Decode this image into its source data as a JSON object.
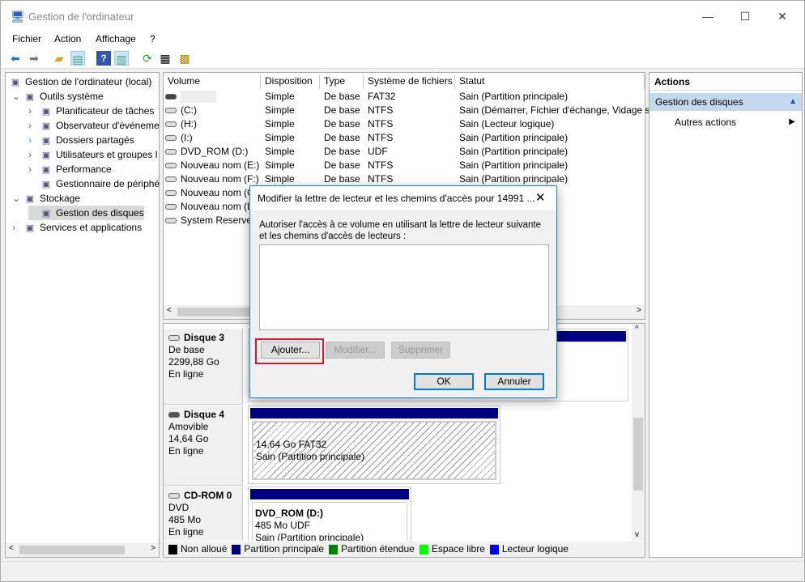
{
  "window": {
    "title": "Gestion de l'ordinateur",
    "controls": [
      "minimize",
      "maximize",
      "close"
    ]
  },
  "menu": [
    "Fichier",
    "Action",
    "Affichage",
    "?"
  ],
  "toolbar": [
    "back-icon",
    "forward-icon",
    "up-folder-icon",
    "show-tree-icon",
    "help-icon",
    "show-action-pane-icon",
    "refresh-icon",
    "properties-icon",
    "settings-icon"
  ],
  "tree": [
    {
      "label": "Gestion de l'ordinateur (local)",
      "level": 0,
      "icon": "computer-icon"
    },
    {
      "label": "Outils système",
      "level": 1,
      "expanded": true,
      "icon": "tools-icon"
    },
    {
      "label": "Planificateur de tâches",
      "level": 2,
      "icon": "clock-icon"
    },
    {
      "label": "Observateur d'événeme",
      "level": 2,
      "icon": "event-viewer-icon"
    },
    {
      "label": "Dossiers partagés",
      "level": 2,
      "icon": "shared-folder-icon"
    },
    {
      "label": "Utilisateurs et groupes l",
      "level": 2,
      "icon": "users-icon"
    },
    {
      "label": "Performance",
      "level": 2,
      "icon": "performance-icon"
    },
    {
      "label": "Gestionnaire de périphé",
      "level": 2,
      "icon": "device-manager-icon"
    },
    {
      "label": "Stockage",
      "level": 1,
      "expanded": true,
      "icon": "storage-icon"
    },
    {
      "label": "Gestion des disques",
      "level": 2,
      "selected": true,
      "icon": "disk-icon"
    },
    {
      "label": "Services et applications",
      "level": 1,
      "icon": "services-icon"
    }
  ],
  "table": {
    "columns": [
      "Volume",
      "Disposition",
      "Type",
      "Système de fichiers",
      "Statut"
    ],
    "rows": [
      [
        "",
        "Simple",
        "De base",
        "FAT32",
        "Sain (Partition principale)"
      ],
      [
        "(C:)",
        "Simple",
        "De base",
        "NTFS",
        "Sain (Démarrer, Fichier d'échange, Vidage su"
      ],
      [
        "(H:)",
        "Simple",
        "De base",
        "NTFS",
        "Sain (Lecteur logique)"
      ],
      [
        "(I:)",
        "Simple",
        "De base",
        "NTFS",
        "Sain (Partition principale)"
      ],
      [
        "DVD_ROM (D:)",
        "Simple",
        "De base",
        "UDF",
        "Sain (Partition principale)"
      ],
      [
        "Nouveau nom (E:)",
        "Simple",
        "De base",
        "NTFS",
        "Sain (Partition principale)"
      ],
      [
        "Nouveau nom (F:)",
        "Simple",
        "De base",
        "NTFS",
        "Sain (Partition principale)"
      ],
      [
        "Nouveau nom (G",
        "",
        "",
        "",
        "e)"
      ],
      [
        "Nouveau nom (L",
        "",
        "",
        "",
        "e)"
      ],
      [
        "System Reserved",
        "",
        "",
        "",
        "rtition principale)"
      ]
    ]
  },
  "disks": [
    {
      "name": "Disque 3",
      "type": "De base",
      "size": "2299,88 Go",
      "state": "En ligne"
    },
    {
      "name": "Disque 4",
      "type": "Amovible",
      "size": "14,64 Go",
      "state": "En ligne",
      "partition": {
        "line1": "14,64 Go FAT32",
        "line2": "Sain (Partition principale)"
      }
    },
    {
      "name": "CD-ROM 0",
      "type": "DVD",
      "size": "485 Mo",
      "state": "En ligne",
      "partition": {
        "title": "DVD_ROM  (D:)",
        "line1": "485 Mo UDF",
        "line2": "Sain (Partition principale)"
      }
    }
  ],
  "legend": [
    {
      "label": "Non alloué",
      "color": "#000000"
    },
    {
      "label": "Partition principale",
      "color": "#000080"
    },
    {
      "label": "Partition étendue",
      "color": "#008000"
    },
    {
      "label": "Espace libre",
      "color": "#00ff00"
    },
    {
      "label": "Lecteur logique",
      "color": "#0000ff"
    }
  ],
  "actions": {
    "header": "Actions",
    "section": "Gestion des disques",
    "item": "Autres actions"
  },
  "dialog": {
    "title": "Modifier la lettre de lecteur et les chemins d'accès pour 14991 ...",
    "description": "Autoriser l'accès à ce volume en utilisant la lettre de lecteur suivante et les chemins d'accès de lecteurs :",
    "add": "Ajouter...",
    "modify": "Modifier...",
    "remove": "Supprimer",
    "ok": "OK",
    "cancel": "Annuler",
    "highlight_color": "#e81123"
  }
}
